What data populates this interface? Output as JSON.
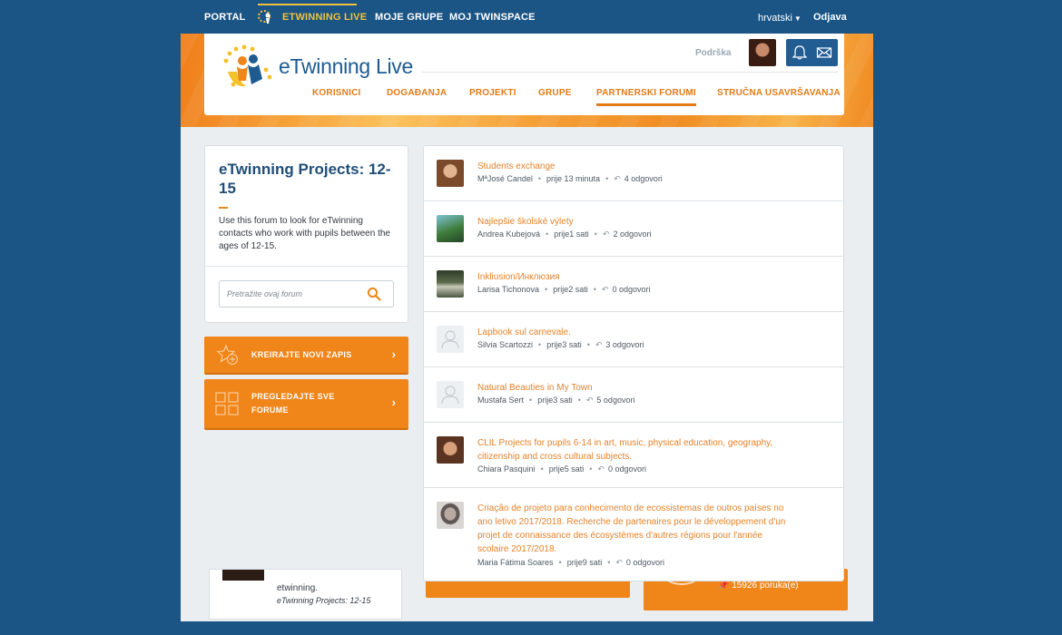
{
  "topnav": {
    "portal": "PORTAL",
    "etwinning_live": "ETWINNING LIVE",
    "moje_grupe": "MOJE GRUPE",
    "moj_twinspace": "MOJ TWINSPACE",
    "language": "hrvatski",
    "logout": "Odjava"
  },
  "header": {
    "brand_e": "e",
    "brand_twinning": "Twinning",
    "brand_live": " Live",
    "support": "Podrška",
    "nav": [
      {
        "label": "KORISNICI"
      },
      {
        "label": "DOGAĐANJA"
      },
      {
        "label": "PROJEKTI"
      },
      {
        "label": "GRUPE"
      },
      {
        "label": "PARTNERSKI FORUMI"
      },
      {
        "label": "STRUČNA USAVRŠAVANJA"
      }
    ]
  },
  "forum": {
    "title": "eTwinning Projects: 12-15",
    "description": "Use this forum to look for eTwinning contacts who work with pupils between the ages of 12-15.",
    "search_placeholder": "Pretražite ovaj forum"
  },
  "actions": {
    "create": "KREIRAJTE NOVI ZAPIS",
    "browse": "PREGLEDAJTE SVE FORUME"
  },
  "posts": [
    {
      "title": "Students exchange",
      "author": "MªJosé Candel",
      "time": "prije 13 minuta",
      "replies": "4 odgovori",
      "avatar": "photo"
    },
    {
      "title": "Najlepšie školské výlety",
      "author": "Andrea Kubejová",
      "time": "prije1 sati",
      "replies": "2 odgovori",
      "avatar": "photo"
    },
    {
      "title": "Inkliusion/Инклюзия",
      "author": "Larisa Tichonova",
      "time": "prije2 sati",
      "replies": "0 odgovori",
      "avatar": "photo"
    },
    {
      "title": "Lapbook sul carnevale.",
      "author": "Silvia Scartozzi",
      "time": "prije3 sati",
      "replies": "3 odgovori",
      "avatar": "placeholder"
    },
    {
      "title": "Natural Beauties in My Town",
      "author": "Mustafa Sert",
      "time": "prije3 sati",
      "replies": "5 odgovori",
      "avatar": "placeholder"
    },
    {
      "title": "CLIL Projects for pupils 6-14 in art, music, physical education, geography, citizenship and cross cultural subjects.",
      "author": "Chiara Pasquini",
      "time": "prije5 sati",
      "replies": "0 odgovori",
      "avatar": "photo"
    },
    {
      "title": "Criação de projeto para conhecimento de ecossistemas de outros países no ano letivo 2017/2018. Recherche de partenaires pour le développement d'un projet de connaissance des écosystèmes d'autres régions pour l'année scolaire 2017/2018.",
      "author": "Maria Fátima Soares",
      "time": "prije9 sati",
      "replies": "0 odgovori",
      "avatar": "photo"
    }
  ],
  "under": {
    "left_text": "etwinning.",
    "left_forum": "eTwinning Projects: 12-15",
    "right_label": "15926 poruka(e)"
  },
  "colors": {
    "page_bg": "#1a5586",
    "accent_orange": "#f08519",
    "link_orange": "#e5832b",
    "navy": "#1f4e79",
    "active_yellow": "#f2c13c"
  }
}
